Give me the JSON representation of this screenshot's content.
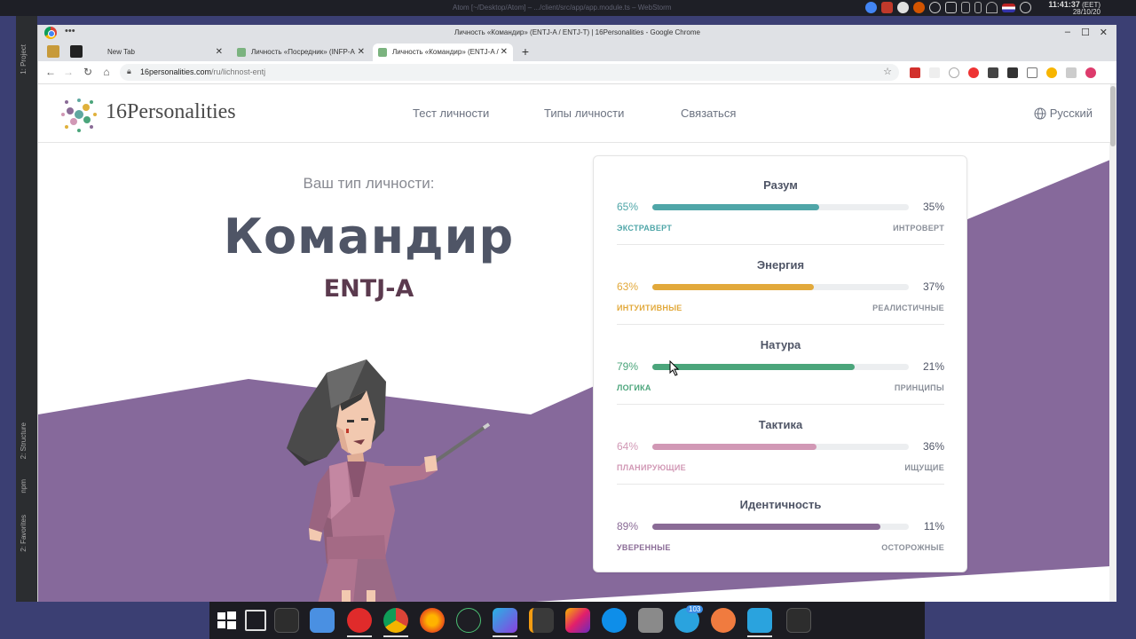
{
  "desktop": {
    "background_window_title": "Atom [~/Desktop/Atom] – .../client/src/app/app.module.ts – WebStorm",
    "clock_time": "11:41:37",
    "clock_tz": "(EET)",
    "clock_date": "28/10/20"
  },
  "ide": {
    "project_label": "1: Project",
    "structure_label": "2: Structure",
    "npm_label": "npm",
    "favorites_label": "2: Favorites"
  },
  "browser": {
    "window_title": "Личность «Командир» (ENTJ-A / ENTJ-T) | 16Personalities - Google Chrome",
    "tabs": [
      {
        "label": "New Tab",
        "active": false
      },
      {
        "label": "Личность «Посредник» (INFP-A",
        "active": false
      },
      {
        "label": "Личность «Командир» (ENTJ-A /",
        "active": true
      }
    ],
    "url_host": "16personalities.com",
    "url_path": "/ru/lichnost-entj"
  },
  "site": {
    "logo_text": "16Personalities",
    "nav": [
      "Тест личности",
      "Типы личности",
      "Связаться"
    ],
    "language": "Русский"
  },
  "hero": {
    "pretitle": "Ваш тип личности:",
    "type_name": "Командир",
    "type_code": "ENTJ-A"
  },
  "traits": [
    {
      "name": "Разум",
      "left_pct": "65%",
      "right_pct": "35%",
      "left_label": "ЭКСТРАВЕРТ",
      "right_label": "ИНТРОВЕРТ",
      "value": 65,
      "color": "#4fa6a8"
    },
    {
      "name": "Энергия",
      "left_pct": "63%",
      "right_pct": "37%",
      "left_label": "ИНТУИТИВНЫЕ",
      "right_label": "РЕАЛИСТИЧНЫЕ",
      "value": 63,
      "color": "#e2a93b"
    },
    {
      "name": "Натура",
      "left_pct": "79%",
      "right_pct": "21%",
      "left_label": "ЛОГИКА",
      "right_label": "ПРИНЦИПЫ",
      "value": 79,
      "color": "#4ba57b"
    },
    {
      "name": "Тактика",
      "left_pct": "64%",
      "right_pct": "36%",
      "left_label": "ПЛАНИРУЮЩИЕ",
      "right_label": "ИЩУЩИЕ",
      "value": 64,
      "color": "#d198b5"
    },
    {
      "name": "Идентичность",
      "left_pct": "89%",
      "right_pct": "11%",
      "left_label": "УВЕРЕННЫЕ",
      "right_label": "ОСТОРОЖНЫЕ",
      "value": 89,
      "color": "#8a6b96"
    }
  ],
  "dock": {
    "telegram_badge": "103",
    "apps": [
      "windows-menu-icon",
      "window-switcher-icon",
      "terminal-icon",
      "file-manager-icon",
      "opera-icon",
      "chrome-icon",
      "firefox-icon",
      "rocket-icon",
      "webstorm-icon",
      "sublime-text-icon",
      "jetbrains-toolbox-icon",
      "teamviewer-icon",
      "settings-icon",
      "telegram-desktop-icon",
      "paw-icon",
      "telegram-icon",
      "console-icon"
    ]
  }
}
